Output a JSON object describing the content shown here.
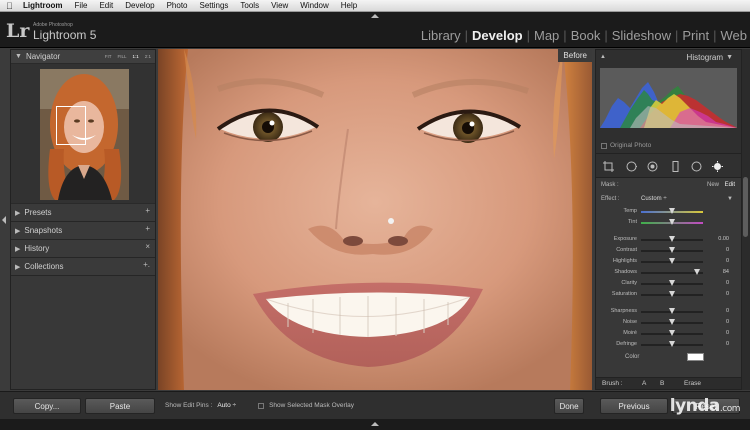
{
  "menubar": {
    "items": [
      "Lightroom",
      "File",
      "Edit",
      "Develop",
      "Photo",
      "Settings",
      "Tools",
      "View",
      "Window",
      "Help"
    ]
  },
  "identity": {
    "badge": "Lr",
    "vendor": "Adobe Photoshop",
    "product": "Lightroom 5"
  },
  "modules": {
    "items": [
      "Library",
      "Develop",
      "Map",
      "Book",
      "Slideshow",
      "Print",
      "Web"
    ],
    "active": "Develop"
  },
  "left_panel": {
    "navigator_title": "Navigator",
    "zoom_options": [
      "FIT",
      "FILL",
      "1:1",
      "2:1"
    ],
    "panels": [
      {
        "label": "Presets",
        "action": "+"
      },
      {
        "label": "Snapshots",
        "action": "+"
      },
      {
        "label": "History",
        "action": "×"
      },
      {
        "label": "Collections",
        "action": "+."
      }
    ]
  },
  "main": {
    "before_label": "Before"
  },
  "right_panel": {
    "histogram_title": "Histogram",
    "original_photo_label": "Original Photo",
    "mask_label": "Mask :",
    "mask_new": "New",
    "mask_edit": "Edit",
    "effect_label": "Effect :",
    "effect_value": "Custom ÷",
    "sliders": [
      {
        "label": "Temp",
        "value": "",
        "pos": 0.5
      },
      {
        "label": "Tint",
        "value": "",
        "pos": 0.5
      },
      {
        "label": "Exposure",
        "value": "0.00",
        "pos": 0.5
      },
      {
        "label": "Contrast",
        "value": "0",
        "pos": 0.5
      },
      {
        "label": "Highlights",
        "value": "0",
        "pos": 0.5
      },
      {
        "label": "Shadows",
        "value": "84",
        "pos": 0.9
      },
      {
        "label": "Clarity",
        "value": "0",
        "pos": 0.5
      },
      {
        "label": "Saturation",
        "value": "0",
        "pos": 0.5
      },
      {
        "label": "Sharpness",
        "value": "0",
        "pos": 0.5
      },
      {
        "label": "Noise",
        "value": "0",
        "pos": 0.5
      },
      {
        "label": "Moiré",
        "value": "0",
        "pos": 0.5
      },
      {
        "label": "Defringe",
        "value": "0",
        "pos": 0.5
      }
    ],
    "color_label": "Color",
    "brush_label": "Brush :",
    "brush_a": "A",
    "brush_b": "B",
    "brush_erase": "Erase"
  },
  "bottombar": {
    "copy": "Copy...",
    "paste": "Paste",
    "show_edit_pins_label": "Show Edit Pins :",
    "show_edit_pins_value": "Auto ÷",
    "show_mask_overlay": "Show Selected Mask Overlay",
    "done": "Done",
    "previous": "Previous",
    "reset": "Reset",
    "watermark": "lynda",
    "watermark_suffix": ".com"
  },
  "colors": {
    "accent": "#ffffff",
    "panel_bg": "#383838",
    "chrome_bg": "#1b1b1b"
  }
}
